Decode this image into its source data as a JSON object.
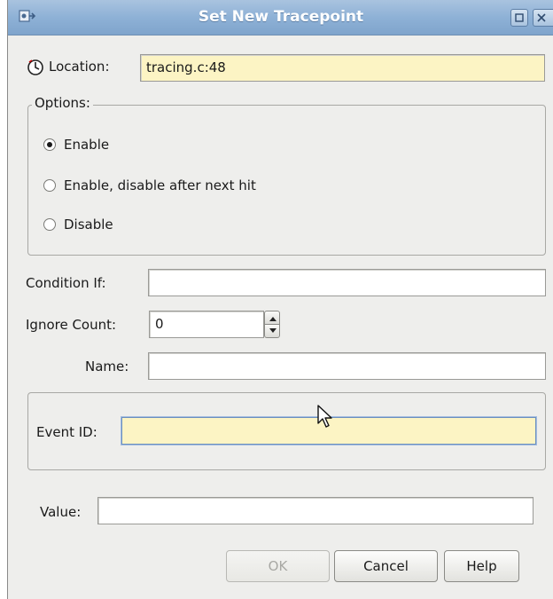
{
  "window": {
    "title": "Set New Tracepoint"
  },
  "location": {
    "label": "Location:",
    "value": "tracing.c:48"
  },
  "options": {
    "legend": "Options:",
    "choices": [
      {
        "label": "Enable",
        "checked": true
      },
      {
        "label": "Enable, disable after next hit",
        "checked": false
      },
      {
        "label": "Disable",
        "checked": false
      }
    ]
  },
  "condition": {
    "label": "Condition If:",
    "value": ""
  },
  "ignore_count": {
    "label": "Ignore Count:",
    "value": "0"
  },
  "name": {
    "label": "Name:",
    "value": ""
  },
  "event_id": {
    "label": "Event ID:",
    "value": ""
  },
  "value_field": {
    "label": "Value:",
    "value": ""
  },
  "buttons": {
    "ok": "OK",
    "cancel": "Cancel",
    "help": "Help"
  },
  "colors": {
    "titlebar": "#8eb1d6",
    "highlight_field": "#fcf4c4",
    "window_bg": "#eeeeec"
  }
}
